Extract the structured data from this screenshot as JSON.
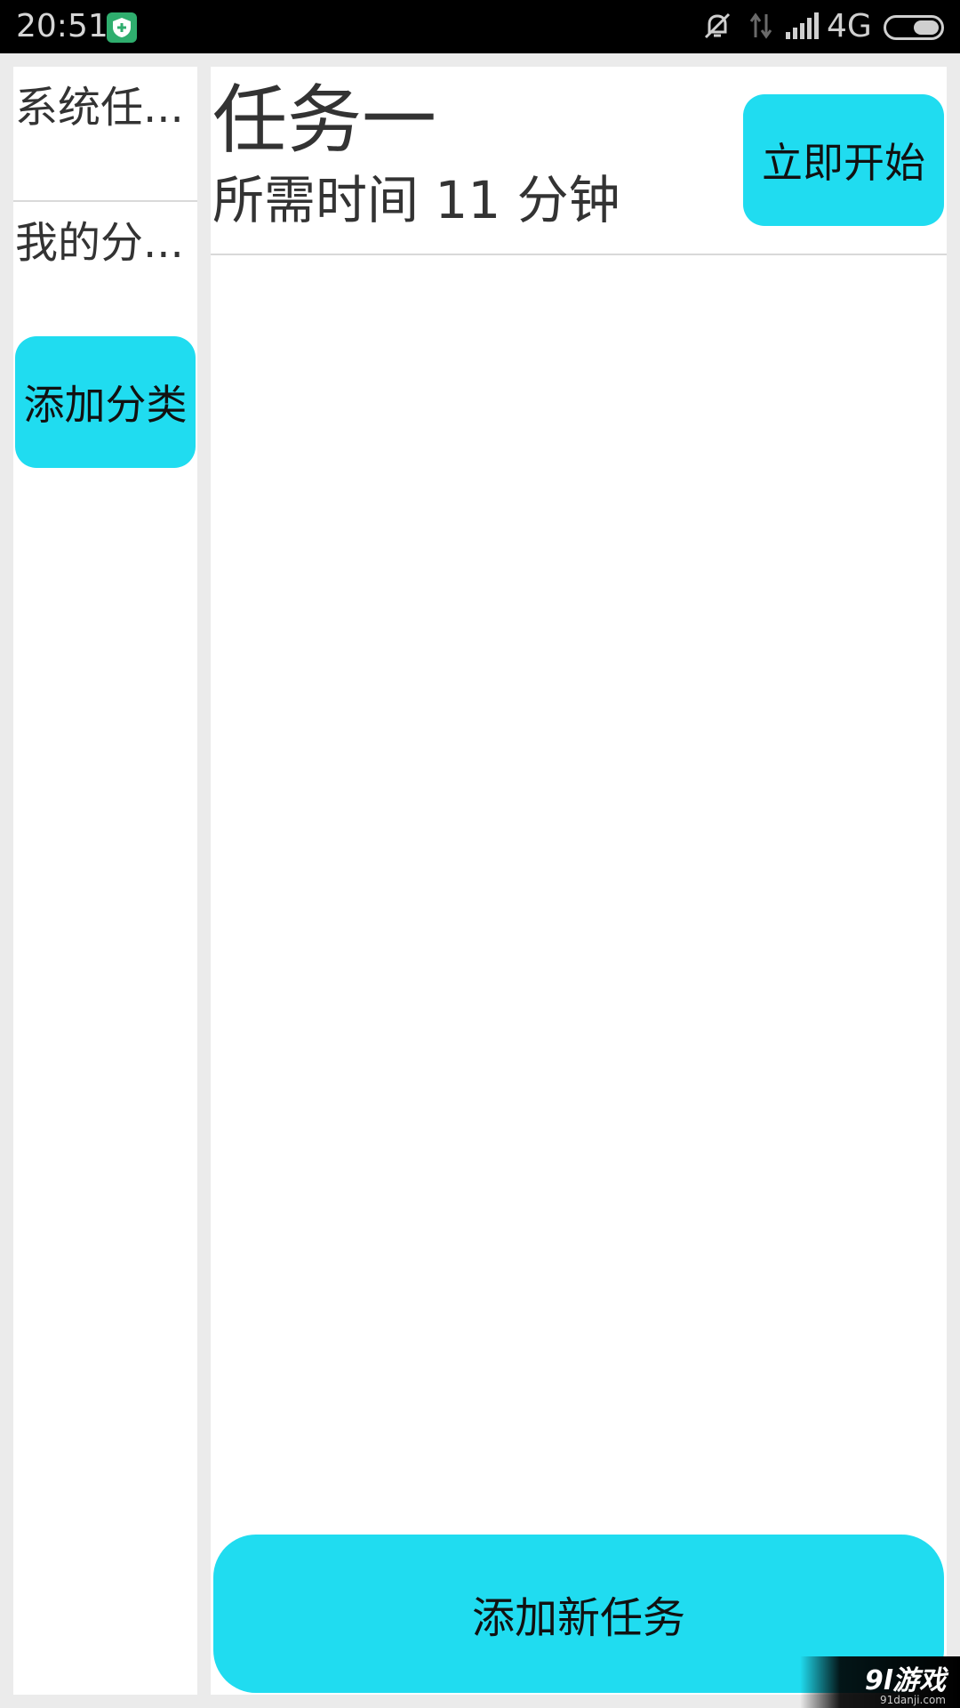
{
  "status_bar": {
    "time": "20:51",
    "network": "4G",
    "icons": [
      "shield-icon",
      "alarm-muted-icon",
      "data-arrows-icon",
      "signal-icon",
      "battery-icon"
    ]
  },
  "sidebar": {
    "items": [
      {
        "label": "系统任..."
      },
      {
        "label": "我的分..."
      }
    ],
    "add_button": "添加分类"
  },
  "tasks": [
    {
      "title": "任务一",
      "time_text": "所需时间  11 分钟",
      "start_label": "立即开始"
    }
  ],
  "footer": {
    "add_task": "添加新任务"
  },
  "watermark": {
    "logo": "9l游戏",
    "url": "91danji.com"
  },
  "colors": {
    "accent": "#20dcf0",
    "background": "#ebebeb",
    "panel": "#ffffff",
    "text": "#333333",
    "status_bar": "#000000"
  }
}
